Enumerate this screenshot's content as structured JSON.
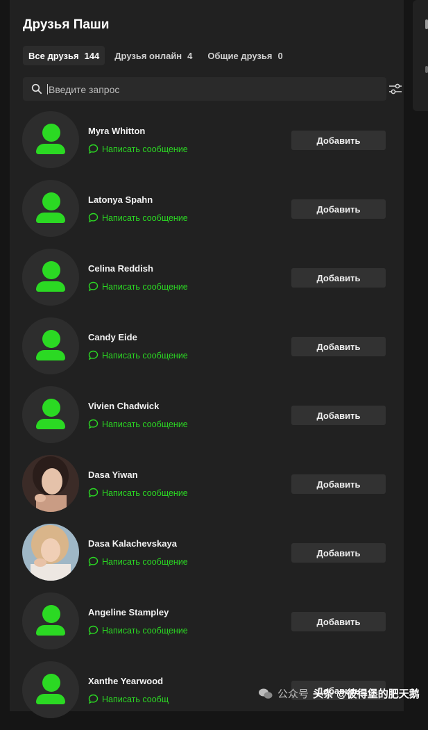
{
  "page": {
    "title": "Друзья Паши"
  },
  "tabs": [
    {
      "label": "Все друзья",
      "count": "144"
    },
    {
      "label": "Друзья онлайн",
      "count": "4"
    },
    {
      "label": "Общие друзья",
      "count": "0"
    }
  ],
  "search": {
    "placeholder": "Введите запрос"
  },
  "friends": [
    {
      "name": "Myra Whitton",
      "message_label": "Написать сообщение",
      "add_label": "Добавить"
    },
    {
      "name": "Latonya Spahn",
      "message_label": "Написать сообщение",
      "add_label": "Добавить"
    },
    {
      "name": "Celina Reddish",
      "message_label": "Написать сообщение",
      "add_label": "Добавить"
    },
    {
      "name": "Candy Eide",
      "message_label": "Написать сообщение",
      "add_label": "Добавить"
    },
    {
      "name": "Vivien Chadwick",
      "message_label": "Написать сообщение",
      "add_label": "Добавить"
    },
    {
      "name": "Dasa Yiwan",
      "message_label": "Написать сообщение",
      "add_label": "Добавить"
    },
    {
      "name": "Dasa Kalachevskaya",
      "message_label": "Написать сообщение",
      "add_label": "Добавить"
    },
    {
      "name": "Angeline Stampley",
      "message_label": "Написать сообщение",
      "add_label": "Добавить"
    },
    {
      "name": "Xanthe Yearwood",
      "message_label": "Написать сообщ",
      "add_label": "Добавить"
    }
  ],
  "watermark": {
    "text_left": "公众号",
    "text_right": "头条 @彼得堡的肥天鹅"
  },
  "colors": {
    "accent": "#2bd923",
    "panel": "#212121",
    "background": "#151515"
  }
}
